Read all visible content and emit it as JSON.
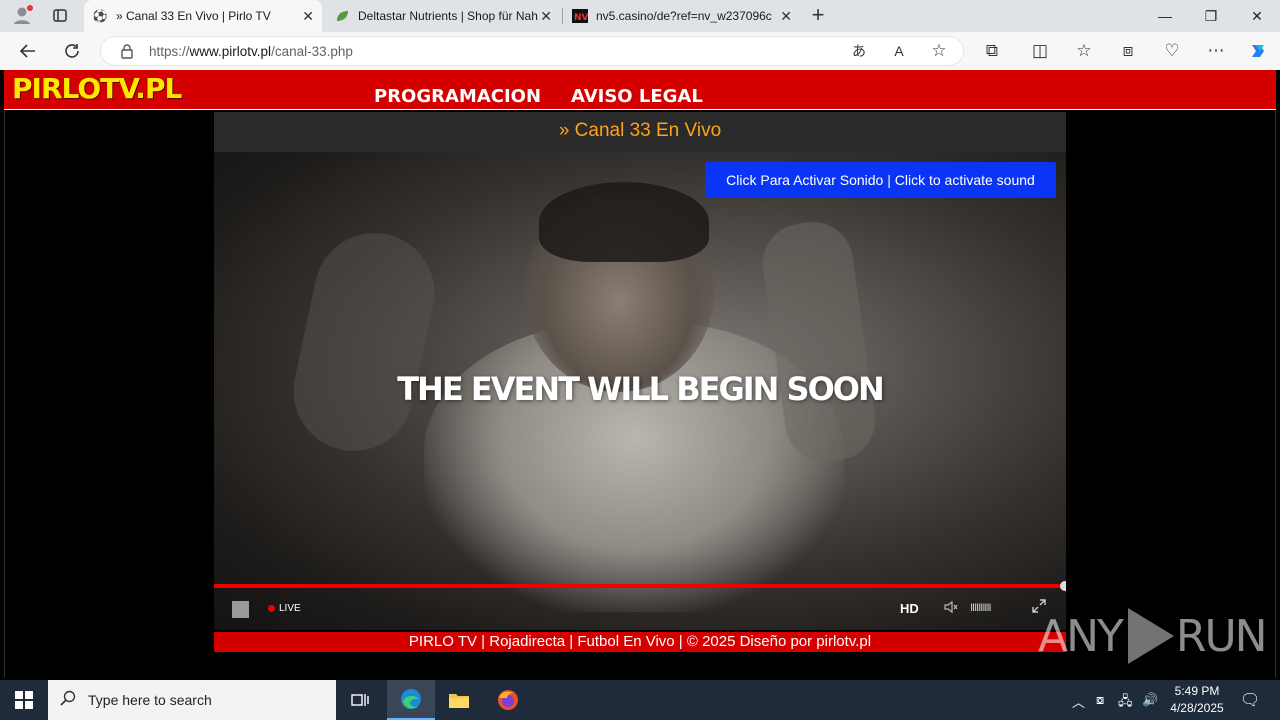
{
  "browser": {
    "tabs": [
      {
        "title": "» Canal 33 En Vivo | Pirlo TV",
        "icon": "soccer-ball-icon"
      },
      {
        "title": "Deltastar Nutrients | Shop für Nah",
        "icon": "leaf-icon"
      },
      {
        "title": "nv5.casino/de?ref=nv_w237096c",
        "icon": "nv-logo-icon"
      }
    ],
    "url_prefix": "https://",
    "url_domain": "www.pirlotv.pl",
    "url_path": "/canal-33.php"
  },
  "site": {
    "logo": "PIRLOTV.PL",
    "menu": [
      "PROGRAMACION",
      "AVISO LEGAL"
    ],
    "channel_title": "» Canal 33 En Vivo",
    "footer": "PIRLO TV | Rojadirecta | Futbol En Vivo | © 2025 Diseño por pirlotv.pl"
  },
  "player": {
    "sound_button": "Click Para Activar Sonido | Click to activate sound",
    "overlay_text": "THE EVENT WILL BEGIN SOON",
    "live_label": "LIVE",
    "hd_label": "HD",
    "volume_bars": "IIIIIIIIII"
  },
  "watermark": {
    "left": "ANY",
    "right": "RUN"
  },
  "taskbar": {
    "search_placeholder": "Type here to search",
    "time": "5:49 PM",
    "date": "4/28/2025"
  }
}
